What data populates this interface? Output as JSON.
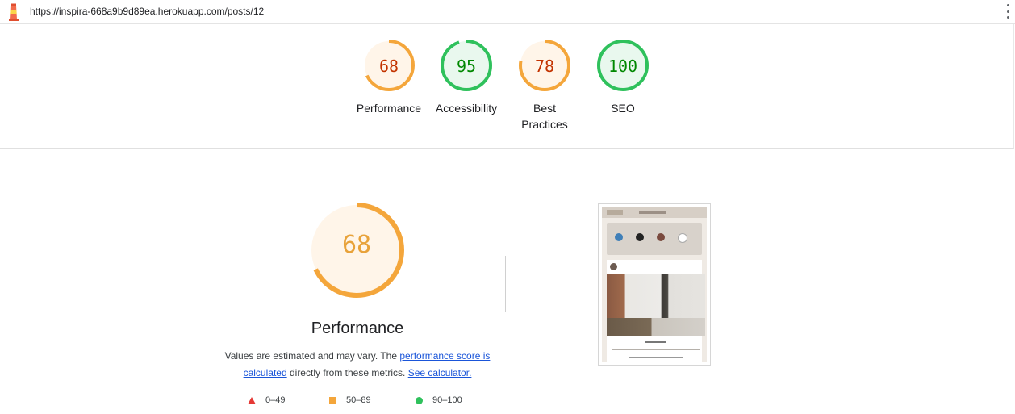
{
  "browser": {
    "url": "https://inspira-668a9b9d89ea.herokuapp.com/posts/12"
  },
  "scores": [
    {
      "label": "Performance",
      "value": 68,
      "color": "#f4a63b",
      "text_color": "#c33300",
      "fill": "#fff5e9"
    },
    {
      "label": "Accessibility",
      "value": 95,
      "color": "#2fc15c",
      "text_color": "#008800",
      "fill": "#e9f8ee"
    },
    {
      "label": "Best\nPractices",
      "value": 78,
      "color": "#f4a63b",
      "text_color": "#c33300",
      "fill": "#fff5e9"
    },
    {
      "label": "SEO",
      "value": 100,
      "color": "#2fc15c",
      "text_color": "#008800",
      "fill": "#e9f8ee"
    }
  ],
  "performance": {
    "score": "68",
    "title": "Performance",
    "desc_before": "Values are estimated and may vary. The ",
    "link_score": "performance score is calculated",
    "desc_middle": " directly from these metrics. ",
    "link_calc": "See calculator."
  },
  "legend": [
    {
      "icon": "fail-triangle-icon",
      "range": "0–49"
    },
    {
      "icon": "average-square-icon",
      "range": "50–89"
    },
    {
      "icon": "pass-circle-icon",
      "range": "90–100"
    }
  ]
}
